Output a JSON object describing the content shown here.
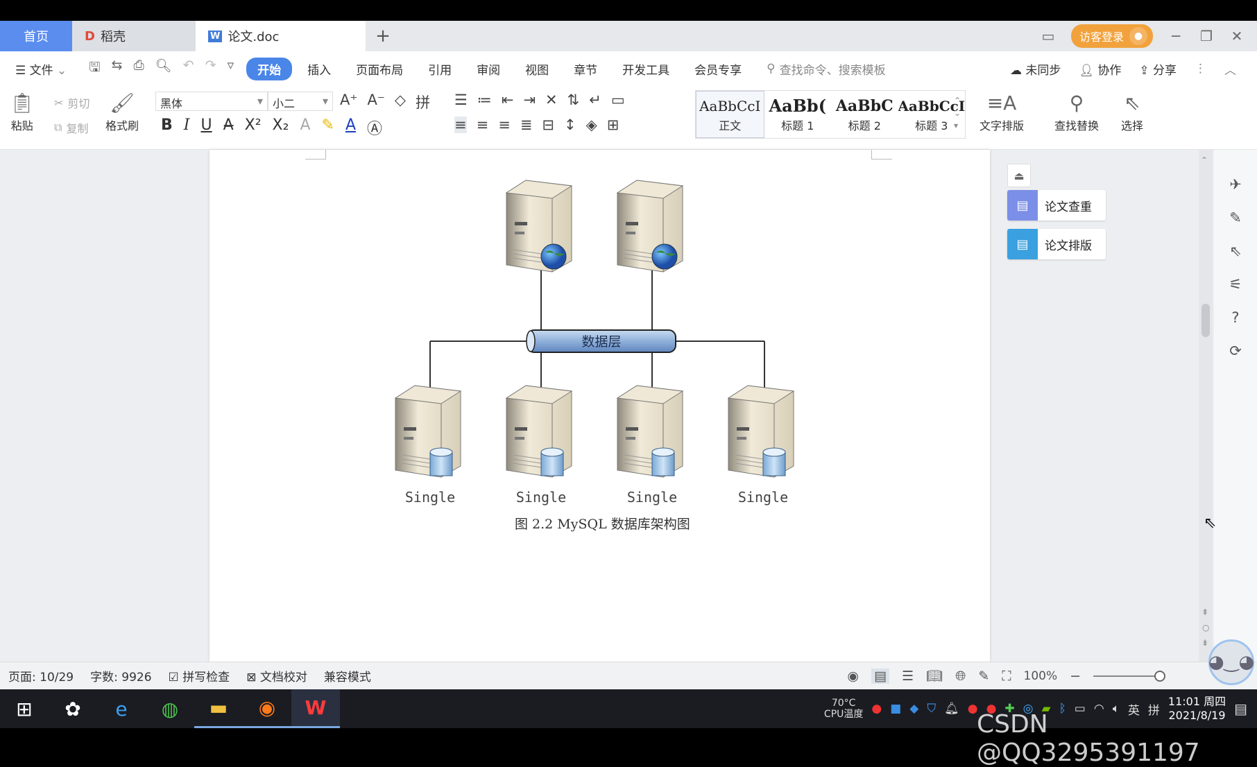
{
  "tabs": {
    "home": "首页",
    "shell": "稻壳",
    "doc": "论文.doc",
    "add": "+"
  },
  "header": {
    "login": "访客登录"
  },
  "menubar": {
    "file": "文件",
    "items": [
      "开始",
      "插入",
      "页面布局",
      "引用",
      "审阅",
      "视图",
      "章节",
      "开发工具",
      "会员专享"
    ],
    "search_placeholder": "查找命令、搜索模板",
    "sync": "未同步",
    "collab": "协作",
    "share": "分享"
  },
  "ribbon": {
    "paste": "粘贴",
    "cut": "剪切",
    "copy": "复制",
    "format_painter": "格式刷",
    "font_name": "黑体",
    "font_size": "小二",
    "styles": [
      {
        "preview": "AaBbCcI",
        "name": "正文"
      },
      {
        "preview": "AaBb(",
        "name": "标题 1"
      },
      {
        "preview": "AaBbC",
        "name": "标题 2"
      },
      {
        "preview": "AaBbCcI",
        "name": "标题 3"
      }
    ],
    "text_layout": "文字排版",
    "find_replace": "查找替换",
    "select": "选择"
  },
  "document": {
    "diagram": {
      "bus_label": "数据层",
      "node_label": "Single",
      "nodes": [
        "Single",
        "Single",
        "Single",
        "Single"
      ]
    },
    "caption": "图 2.2 MySQL 数据库架构图"
  },
  "side_tools": {
    "check": "论文查重",
    "layout": "论文排版"
  },
  "status": {
    "page": "页面: 10/29",
    "words": "字数: 9926",
    "spell": "拼写检查",
    "proof": "文档校对",
    "compat": "兼容模式",
    "zoom": "100%"
  },
  "taskbar": {
    "temp": "70°C",
    "temp_label": "CPU温度",
    "ime_lang": "英",
    "ime_mode": "拼",
    "time": "11:01 周四",
    "date": "2021/8/19"
  },
  "watermark": "CSDN @QQ3295391197",
  "colors": {
    "accent": "#4a86e8",
    "home_tab": "#5b8def",
    "login": "#f2a23c",
    "paper_check": "#7b8fe8",
    "paper_layout": "#3aa0e0"
  }
}
